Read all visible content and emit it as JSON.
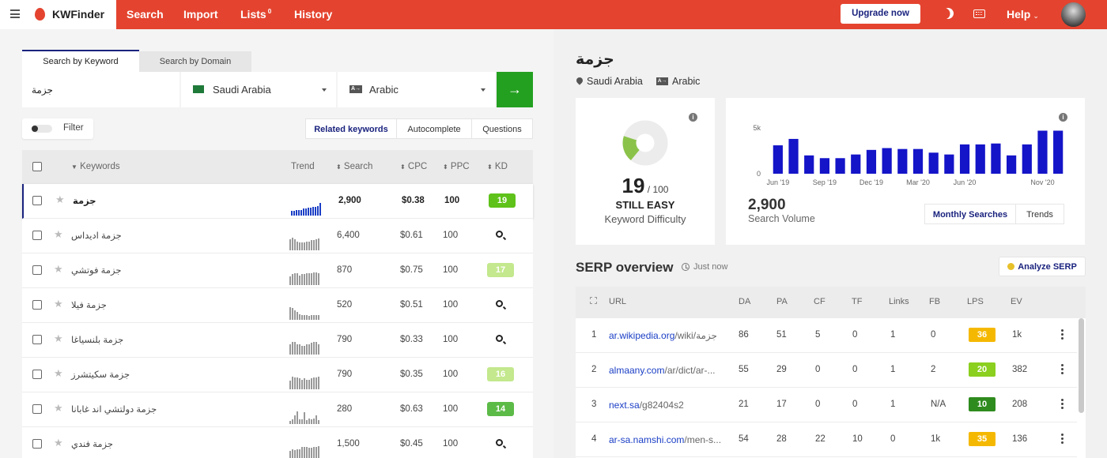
{
  "nav": {
    "brand": "KWFinder",
    "items": [
      {
        "label": "Search"
      },
      {
        "label": "Import"
      },
      {
        "label": "Lists",
        "badge": "0"
      },
      {
        "label": "History"
      }
    ],
    "upgrade": "Upgrade now",
    "help": "Help",
    "colors": {
      "bar": "#e4442f",
      "accent": "#1a237e"
    }
  },
  "search": {
    "tabs": [
      "Search by Keyword",
      "Search by Domain"
    ],
    "keyword": "جزمة",
    "location": "Saudi Arabia",
    "language": "Arabic",
    "lang_icon": "A→",
    "go_icon": "arrow-right"
  },
  "filter": {
    "label": "Filter"
  },
  "modes": [
    "Related keywords",
    "Autocomplete",
    "Questions"
  ],
  "table": {
    "headers": {
      "keywords": "Keywords",
      "trend": "Trend",
      "search": "Search",
      "cpc": "CPC",
      "ppc": "PPC",
      "kd": "KD"
    },
    "rows": [
      {
        "keyword": "جزمة",
        "search": "2,900",
        "cpc": "$0.38",
        "ppc": "100",
        "kd": "19",
        "kd_color": "#5fc21a",
        "trend": [
          5,
          5,
          6,
          6,
          6,
          7,
          7,
          8,
          8,
          9,
          9,
          10,
          13
        ]
      },
      {
        "keyword": "جزمة اديداس",
        "search": "6,400",
        "cpc": "$0.61",
        "ppc": "100",
        "kd": "",
        "trend": [
          12,
          14,
          12,
          10,
          9,
          9,
          9,
          10,
          10,
          11,
          11,
          12,
          13
        ]
      },
      {
        "keyword": "جزمة فوتشي",
        "search": "870",
        "cpc": "$0.75",
        "ppc": "100",
        "kd": "17",
        "kd_color": "#c3e88d",
        "trend": [
          9,
          11,
          12,
          12,
          10,
          11,
          11,
          12,
          12,
          12,
          13,
          13,
          12
        ]
      },
      {
        "keyword": "جزمة فيلا",
        "search": "520",
        "cpc": "$0.51",
        "ppc": "100",
        "kd": "",
        "trend": [
          13,
          12,
          10,
          8,
          6,
          5,
          5,
          5,
          4,
          5,
          5,
          5,
          5
        ]
      },
      {
        "keyword": "جزمة بلنسياغا",
        "search": "790",
        "cpc": "$0.33",
        "ppc": "100",
        "kd": "",
        "trend": [
          10,
          12,
          12,
          10,
          10,
          8,
          8,
          10,
          10,
          11,
          12,
          12,
          10
        ]
      },
      {
        "keyword": "جزمة سكيتشرز",
        "search": "790",
        "cpc": "$0.35",
        "ppc": "100",
        "kd": "16",
        "kd_color": "#c3e88d",
        "trend": [
          9,
          13,
          12,
          12,
          11,
          10,
          11,
          10,
          10,
          11,
          12,
          12,
          13
        ]
      },
      {
        "keyword": "جزمة دولتشي اند غابانا",
        "search": "280",
        "cpc": "$0.63",
        "ppc": "100",
        "kd": "14",
        "kd_color": "#5cba47",
        "trend": [
          3,
          5,
          9,
          13,
          5,
          5,
          12,
          4,
          6,
          5,
          6,
          9,
          4
        ]
      },
      {
        "keyword": "جزمة فندي",
        "search": "1,500",
        "cpc": "$0.45",
        "ppc": "100",
        "kd": "",
        "trend": [
          8,
          10,
          9,
          10,
          10,
          12,
          12,
          12,
          11,
          11,
          12,
          12,
          13
        ]
      }
    ]
  },
  "overview": {
    "title": "جزمة",
    "location": "Saudi Arabia",
    "language": "Arabic",
    "lang_icon": "A→",
    "difficulty": {
      "value": 19,
      "max": "/ 100",
      "label": "STILL EASY",
      "sub": "Keyword Difficulty",
      "color": "#8bc34a"
    },
    "volume": {
      "value": "2,900",
      "label": "Search Volume",
      "tabs": [
        "Monthly Searches",
        "Trends"
      ]
    }
  },
  "chart_data": {
    "type": "bar",
    "categories": [
      "Jun '19",
      "Jul '19",
      "Aug '19",
      "Sep '19",
      "Oct '19",
      "Nov '19",
      "Dec '19",
      "Jan '20",
      "Feb '20",
      "Mar '20",
      "Apr '20",
      "May '20",
      "Jun '20",
      "Jul '20",
      "Aug '20",
      "Sep '20",
      "Oct '20",
      "Nov '20",
      "Dec '20"
    ],
    "x_tick_labels": [
      "Jun '19",
      "Sep '19",
      "Dec '19",
      "Mar '20",
      "Jun '20",
      "Nov '20"
    ],
    "values": [
      3100,
      3800,
      2000,
      1700,
      1700,
      2100,
      2600,
      2800,
      2700,
      2700,
      2300,
      2100,
      3200,
      3200,
      3300,
      2000,
      3200,
      4700,
      4700
    ],
    "y_ticks": [
      "0",
      "5k"
    ],
    "ylim": [
      0,
      5000
    ],
    "color": "#1414c8",
    "grid": true
  },
  "serp": {
    "title": "SERP overview",
    "time": "Just now",
    "analyze": "Analyze SERP",
    "headers": [
      "URL",
      "DA",
      "PA",
      "CF",
      "TF",
      "Links",
      "FB",
      "LPS",
      "EV"
    ],
    "rows": [
      {
        "n": "1",
        "domain": "ar.wikipedia.org",
        "path": "/wiki/جزمة",
        "da": "86",
        "pa": "51",
        "cf": "5",
        "tf": "0",
        "links": "1",
        "fb": "0",
        "lps": "36",
        "lps_color": "#f5b800",
        "ev": "1k"
      },
      {
        "n": "2",
        "domain": "almaany.com",
        "path": "/ar/dict/ar-...",
        "da": "55",
        "pa": "29",
        "cf": "0",
        "tf": "0",
        "links": "1",
        "fb": "2",
        "lps": "20",
        "lps_color": "#8bcf1f",
        "ev": "382"
      },
      {
        "n": "3",
        "domain": "next.sa",
        "path": "/g82404s2",
        "da": "21",
        "pa": "17",
        "cf": "0",
        "tf": "0",
        "links": "1",
        "fb": "N/A",
        "lps": "10",
        "lps_color": "#2e8b1e",
        "ev": "208"
      },
      {
        "n": "4",
        "domain": "ar-sa.namshi.com",
        "path": "/men-s...",
        "da": "54",
        "pa": "28",
        "cf": "22",
        "tf": "10",
        "links": "0",
        "fb": "1k",
        "lps": "35",
        "lps_color": "#f5b800",
        "ev": "136"
      }
    ]
  }
}
